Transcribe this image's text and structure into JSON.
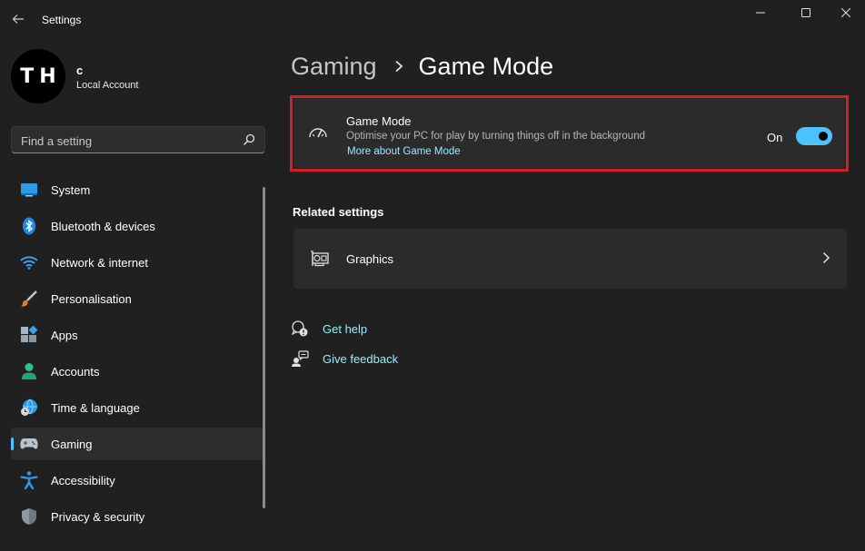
{
  "window": {
    "title": "Settings",
    "back_icon": "back-arrow-icon",
    "controls": [
      "minimize-icon",
      "maximize-icon",
      "close-icon"
    ]
  },
  "profile": {
    "avatar_text": "TH",
    "name": "c",
    "account_type": "Local Account"
  },
  "search": {
    "placeholder": "Find a setting",
    "icon": "search-icon"
  },
  "sidebar": {
    "items": [
      {
        "label": "System",
        "icon": "system-icon",
        "active": false
      },
      {
        "label": "Bluetooth & devices",
        "icon": "bluetooth-icon",
        "active": false
      },
      {
        "label": "Network & internet",
        "icon": "wifi-icon",
        "active": false
      },
      {
        "label": "Personalisation",
        "icon": "brush-icon",
        "active": false
      },
      {
        "label": "Apps",
        "icon": "apps-icon",
        "active": false
      },
      {
        "label": "Accounts",
        "icon": "accounts-icon",
        "active": false
      },
      {
        "label": "Time & language",
        "icon": "globe-clock-icon",
        "active": false
      },
      {
        "label": "Gaming",
        "icon": "gamepad-icon",
        "active": true
      },
      {
        "label": "Accessibility",
        "icon": "accessibility-icon",
        "active": false
      },
      {
        "label": "Privacy & security",
        "icon": "shield-icon",
        "active": false
      }
    ]
  },
  "breadcrumb": {
    "parent": "Gaming",
    "current": "Game Mode"
  },
  "game_mode": {
    "title": "Game Mode",
    "description": "Optimise your PC for play by turning things off in the background",
    "link": "More about Game Mode",
    "state_label": "On",
    "enabled": true,
    "icon": "speedometer-icon"
  },
  "related": {
    "heading": "Related settings",
    "items": [
      {
        "label": "Graphics",
        "icon": "graphics-card-icon"
      }
    ]
  },
  "help": {
    "get_help": "Get help",
    "give_feedback": "Give feedback"
  },
  "colors": {
    "accent": "#4cc2ff",
    "link": "#99ebff",
    "highlight": "#d31f2a",
    "background": "#202020",
    "card": "#2b2b2b"
  }
}
